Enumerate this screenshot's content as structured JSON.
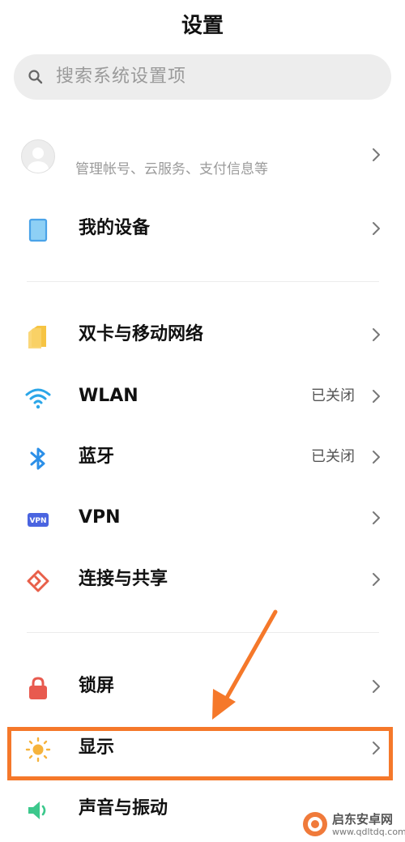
{
  "header": {
    "title": "设置"
  },
  "search": {
    "placeholder": "搜索系统设置项"
  },
  "account": {
    "subtitle": "管理帐号、云服务、支付信息等"
  },
  "sections": [
    {
      "items": [
        {
          "label": "我的设备",
          "icon": "tablet-icon"
        }
      ]
    },
    {
      "items": [
        {
          "label": "双卡与移动网络",
          "icon": "sim-card-icon"
        },
        {
          "label": "WLAN",
          "status": "已关闭",
          "icon": "wifi-icon"
        },
        {
          "label": "蓝牙",
          "status": "已关闭",
          "icon": "bluetooth-icon"
        },
        {
          "label": "VPN",
          "icon": "vpn-icon",
          "icon_text": "VPN"
        },
        {
          "label": "连接与共享",
          "icon": "share-icon"
        }
      ]
    },
    {
      "items": [
        {
          "label": "锁屏",
          "icon": "lock-icon"
        },
        {
          "label": "显示",
          "icon": "sun-icon",
          "highlighted": true
        },
        {
          "label": "声音与振动",
          "icon": "speaker-icon"
        }
      ]
    }
  ],
  "watermark": {
    "line1": "启东安卓网",
    "line2": "www.qdltdq.com"
  },
  "colors": {
    "highlight": "#f5782a",
    "wifi": "#2ba6e8",
    "bluetooth": "#2b8fe8",
    "sim": "#f6c443",
    "vpn": "#4a64e0",
    "share": "#e8604a",
    "lock": "#e85a4f",
    "sun": "#f6b33c",
    "speaker": "#3cc88c",
    "device": "#4aa3e8"
  }
}
